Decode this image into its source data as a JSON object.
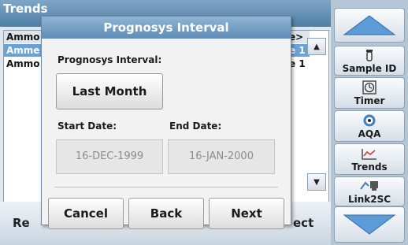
{
  "background": {
    "title": "Trends",
    "rows": [
      {
        "left": "Ammo",
        "right": "e>"
      },
      {
        "left": "Amme",
        "right": "e 1"
      },
      {
        "left": "Ammo",
        "right": "e 1"
      }
    ],
    "bottom_left": "Re",
    "bottom_right": "ect"
  },
  "toolbar": {
    "sample_id": "Sample ID",
    "timer": "Timer",
    "aqa": "AQA",
    "trends": "Trends",
    "link2sc": "Link2SC"
  },
  "dialog": {
    "title": "Prognosys Interval",
    "interval_label": "Prognosys Interval:",
    "interval_value": "Last Month",
    "start_label": "Start Date:",
    "end_label": "End Date:",
    "start_date": "16-DEC-1999",
    "end_date": "16-JAN-2000",
    "cancel": "Cancel",
    "back": "Back",
    "next": "Next"
  }
}
